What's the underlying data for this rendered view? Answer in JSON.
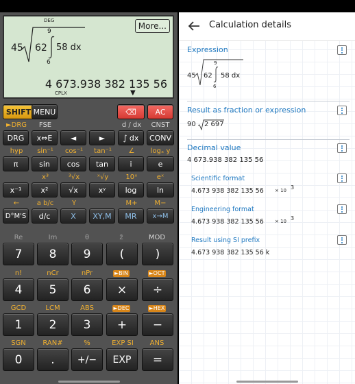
{
  "calculator": {
    "display": {
      "angle_mode": "DEG",
      "more_button": "More...",
      "expr_coef": "45",
      "expr_radicand": "62",
      "integral_upper": "9",
      "integral_lower": "6",
      "integrand": "58 dx",
      "result": "4 673.938 382 135 56",
      "mode": "CPLX",
      "indicator": "▼"
    },
    "rows": [
      {
        "labels": [
          "",
          "",
          "",
          "",
          "",
          ""
        ],
        "keys": [
          "SHIFT",
          "MENU",
          "",
          "",
          "⌫",
          "AC"
        ]
      },
      {
        "labels": [
          "►DRG",
          "FSE",
          "",
          "",
          "d / dx",
          "CNST"
        ],
        "keys": [
          "DRG",
          "x⇔E",
          "◄",
          "►",
          "∫ dx",
          "CONV"
        ]
      },
      {
        "labels": [
          "hyp",
          "sin⁻¹",
          "cos⁻¹",
          "tan⁻¹",
          "∠",
          "logₓ y"
        ],
        "keys": [
          "π",
          "sin",
          "cos",
          "tan",
          "i",
          "e"
        ]
      },
      {
        "labels": [
          "",
          "x³",
          "³√x",
          "ˣ√y",
          "10ˣ",
          "eˣ"
        ],
        "keys": [
          "x⁻¹",
          "x²",
          "√x",
          "xʸ",
          "log",
          "ln"
        ]
      },
      {
        "labels": [
          "←",
          "a b/c",
          "Y",
          "",
          "M+",
          "M−"
        ],
        "keys": [
          "D°M'S",
          "d/c",
          "X",
          "XY,M",
          "MR",
          "x→M"
        ]
      }
    ],
    "big_rows": [
      {
        "labels": [
          "Re",
          "Im",
          "θ",
          "z̄",
          "MOD"
        ],
        "keys": [
          "7",
          "8",
          "9",
          "(",
          ")"
        ]
      },
      {
        "labels": [
          "n!",
          "nCr",
          "nPr",
          "►BIN",
          "►OCT"
        ],
        "keys": [
          "4",
          "5",
          "6",
          "×",
          "÷"
        ]
      },
      {
        "labels": [
          "GCD",
          "LCM",
          "ABS",
          "►DEC",
          "►HEX"
        ],
        "keys": [
          "1",
          "2",
          "3",
          "+",
          "−"
        ]
      },
      {
        "labels": [
          "SGN",
          "RAN#",
          "%",
          "EXP SI",
          "ANS"
        ],
        "keys": [
          "0",
          ".",
          "+/−",
          "EXP",
          "="
        ]
      }
    ]
  },
  "details": {
    "title": "Calculation details",
    "sections": {
      "expression": {
        "title": "Expression",
        "coef": "45",
        "radicand": "62",
        "upper": "9",
        "lower": "6",
        "integrand": "58 dx"
      },
      "fraction": {
        "title": "Result as fraction or expression",
        "coef": "90",
        "radicand": "2 697"
      },
      "decimal": {
        "title": "Decimal value",
        "value": "4 673.938 382 135 56"
      },
      "scientific": {
        "title": "Scientific format",
        "mantissa": "4.673 938 382 135 56",
        "times": "× 10",
        "exp": "3"
      },
      "engineering": {
        "title": "Engineering format",
        "mantissa": "4.673 938 382 135 56",
        "times": "× 10",
        "exp": "3"
      },
      "si": {
        "title": "Result using SI prefix",
        "value": "4.673 938 382 135 56 k"
      }
    }
  }
}
